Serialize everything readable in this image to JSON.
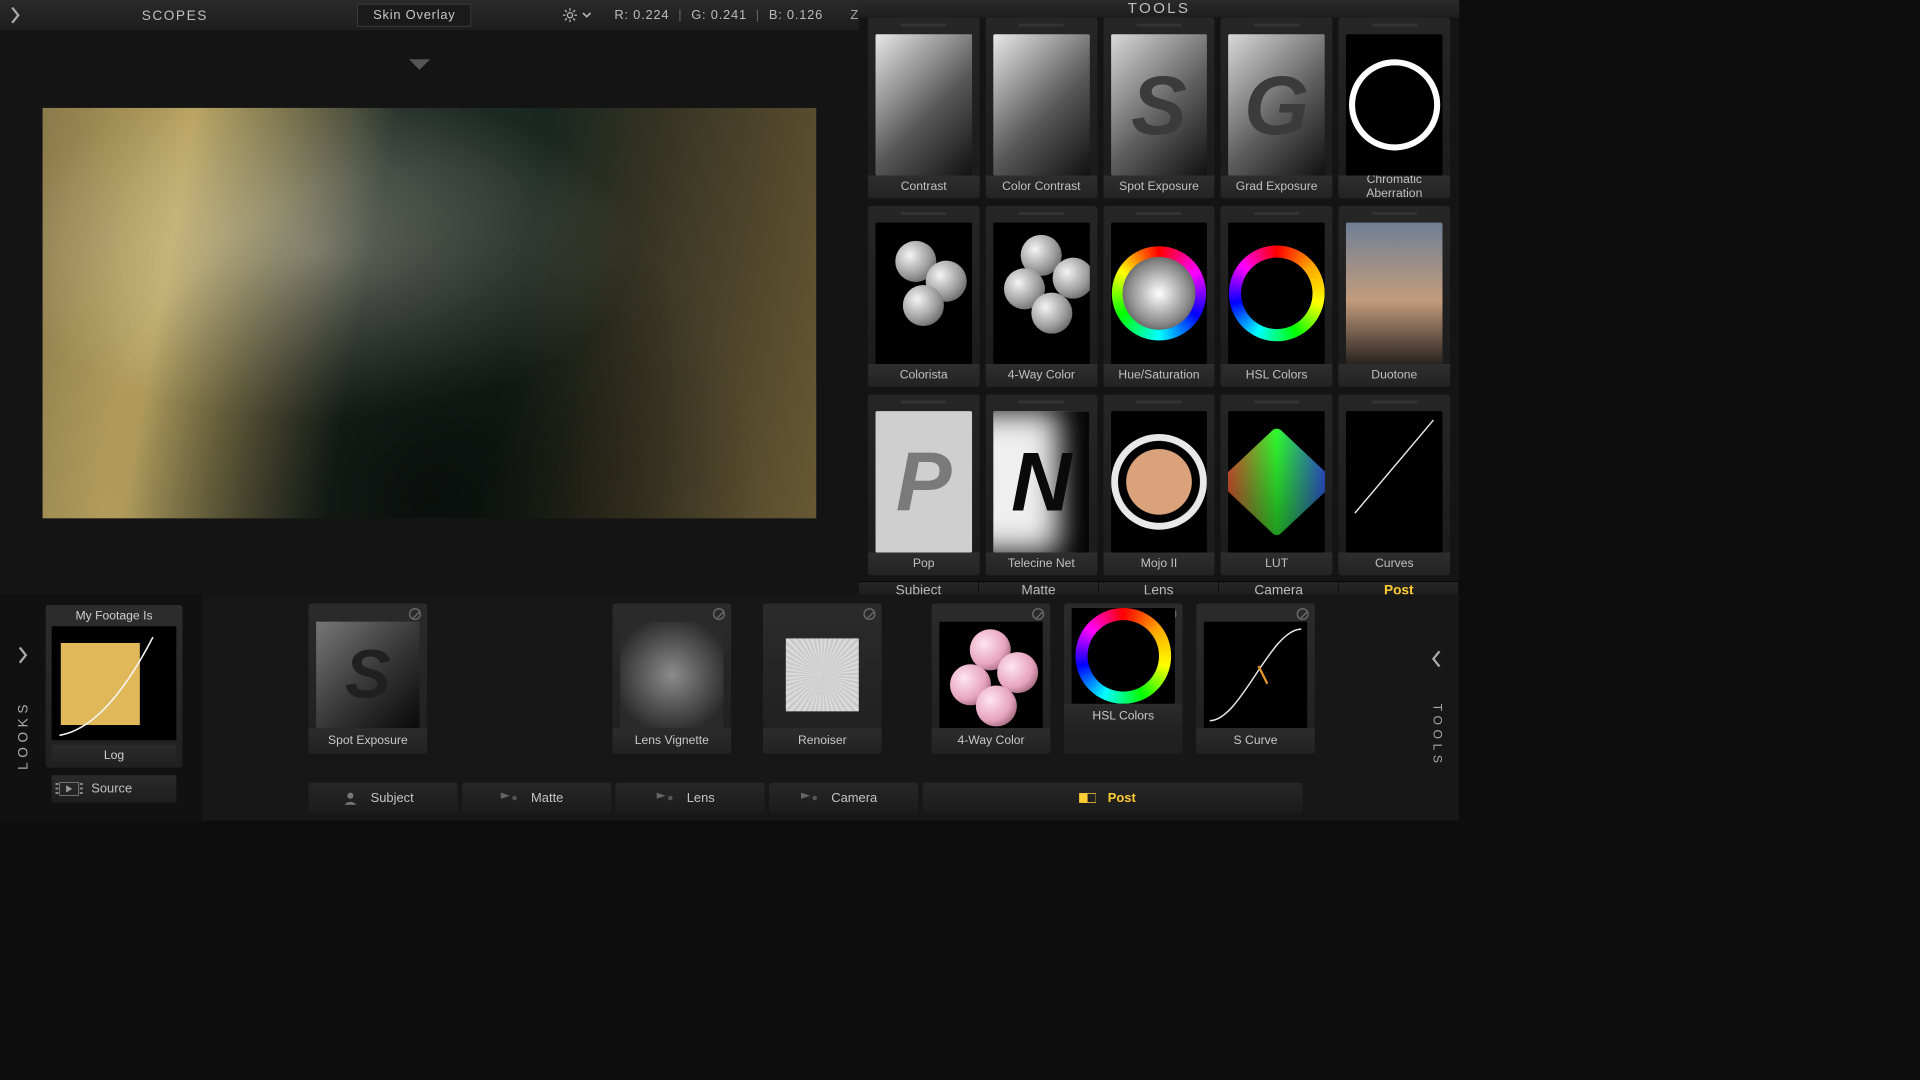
{
  "topbar": {
    "scopes_label": "SCOPES",
    "overlay_dropdown": "Skin Overlay",
    "rgb": {
      "r": "R: 0.224",
      "g": "G: 0.241",
      "b": "B: 0.126"
    },
    "zoom_label": "Zo"
  },
  "tools_panel": {
    "title": "TOOLS",
    "cards": [
      {
        "label": "Contrast",
        "thumb": "grad-gray"
      },
      {
        "label": "Color Contrast",
        "thumb": "grad-gray"
      },
      {
        "label": "Spot Exposure",
        "thumb": "letter-S"
      },
      {
        "label": "Grad Exposure",
        "thumb": "letter-G"
      },
      {
        "label": "Chromatic Aberration",
        "thumb": "ring"
      },
      {
        "label": "Colorista",
        "thumb": "three-balls"
      },
      {
        "label": "4-Way Color",
        "thumb": "four-balls"
      },
      {
        "label": "Hue/Saturation",
        "thumb": "hue-wheel"
      },
      {
        "label": "HSL Colors",
        "thumb": "hsl-ring"
      },
      {
        "label": "Duotone",
        "thumb": "duotone"
      },
      {
        "label": "Pop",
        "thumb": "pop"
      },
      {
        "label": "Telecine Net",
        "thumb": "tnet"
      },
      {
        "label": "Mojo II",
        "thumb": "mojo"
      },
      {
        "label": "LUT",
        "thumb": "lut"
      },
      {
        "label": "Curves",
        "thumb": "curves"
      }
    ],
    "tabs": [
      {
        "label": "Subject",
        "active": false
      },
      {
        "label": "Matte",
        "active": false
      },
      {
        "label": "Lens",
        "active": false
      },
      {
        "label": "Camera",
        "active": false
      },
      {
        "label": "Post",
        "active": true
      }
    ]
  },
  "looks": {
    "rail_label": "LOOKS",
    "footage_title": "My Footage Is",
    "footage_label": "Log",
    "source_button": "Source"
  },
  "right_rail": {
    "label": "TOOLS"
  },
  "pipeline": {
    "cards": [
      {
        "label": "Spot Exposure",
        "thumb": "letter-S-dim"
      },
      {
        "label": "Lens Vignette",
        "thumb": "vignette"
      },
      {
        "label": "Renoiser",
        "thumb": "renoise"
      },
      {
        "label": "4-Way Color",
        "thumb": "four-balls-pink"
      },
      {
        "label": "HSL Colors",
        "thumb": "hsl-ring"
      },
      {
        "label": "S Curve",
        "thumb": "scurve"
      }
    ],
    "tabs": [
      {
        "label": "Subject",
        "active": false
      },
      {
        "label": "Matte",
        "active": false
      },
      {
        "label": "Lens",
        "active": false
      },
      {
        "label": "Camera",
        "active": false
      },
      {
        "label": "Post",
        "active": true
      }
    ]
  }
}
